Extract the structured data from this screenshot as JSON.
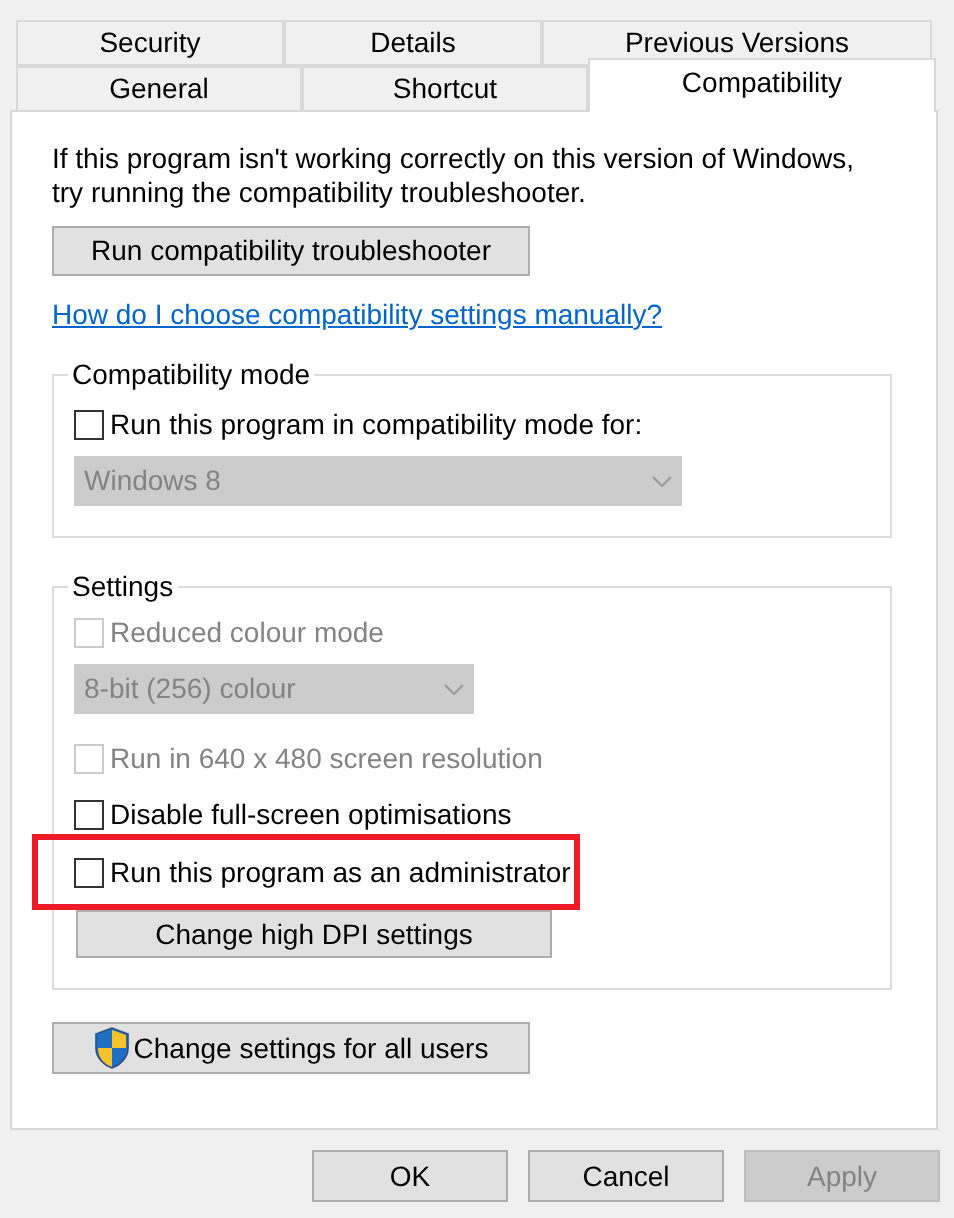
{
  "tabs_back_row": [
    {
      "label": "Security",
      "selected": false
    },
    {
      "label": "Details",
      "selected": false
    },
    {
      "label": "Previous Versions",
      "selected": false
    }
  ],
  "tabs_front_row": [
    {
      "label": "General",
      "selected": false
    },
    {
      "label": "Shortcut",
      "selected": false
    },
    {
      "label": "Compatibility",
      "selected": true
    }
  ],
  "intro": "If this program isn't working correctly on this version of Windows, try running the compatibility troubleshooter.",
  "troubleshooter_button": "Run compatibility troubleshooter",
  "help_link": "How do I choose compatibility settings manually?",
  "compatibility_mode": {
    "title": "Compatibility mode",
    "checkbox": {
      "label": "Run this program in compatibility mode for:",
      "checked": false,
      "disabled": false
    },
    "dropdown": {
      "value": "Windows 8",
      "disabled": true
    }
  },
  "settings": {
    "title": "Settings",
    "items": [
      {
        "kind": "checkbox",
        "label": "Reduced colour mode",
        "checked": false,
        "disabled": true,
        "highlighted": false
      },
      {
        "kind": "dropdown",
        "value": "8-bit (256) colour",
        "disabled": true
      },
      {
        "kind": "checkbox",
        "label": "Run in 640 x 480 screen resolution",
        "checked": false,
        "disabled": true,
        "highlighted": false
      },
      {
        "kind": "checkbox",
        "label": "Disable full-screen optimisations",
        "checked": false,
        "disabled": false,
        "highlighted": false
      },
      {
        "kind": "checkbox",
        "label": "Run this program as an administrator",
        "checked": false,
        "disabled": false,
        "highlighted": true
      },
      {
        "kind": "button",
        "label": "Change high DPI settings"
      }
    ]
  },
  "all_users_button": "Change settings for all users",
  "dialog_buttons": [
    {
      "label": "OK",
      "disabled": false
    },
    {
      "label": "Cancel",
      "disabled": false
    },
    {
      "label": "Apply",
      "disabled": true
    }
  ]
}
